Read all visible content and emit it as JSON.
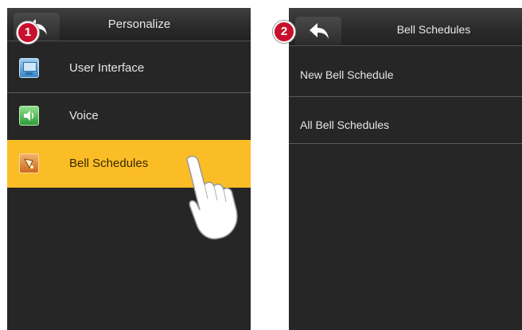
{
  "step1": {
    "badge": "1"
  },
  "step2": {
    "badge": "2"
  },
  "left_screen": {
    "title": "Personalize",
    "items": [
      {
        "label": "User Interface",
        "icon": "monitor-icon"
      },
      {
        "label": "Voice",
        "icon": "speaker-icon"
      },
      {
        "label": "Bell Schedules",
        "icon": "bell-icon",
        "selected": true
      }
    ]
  },
  "right_screen": {
    "title": "Bell Schedules",
    "items": [
      {
        "label": "New Bell Schedule"
      },
      {
        "label": "All Bell Schedules"
      }
    ]
  },
  "colors": {
    "panel_bg": "#262626",
    "highlight": "#fbbd26",
    "badge": "#c8102e",
    "text": "#e6e6e6"
  }
}
